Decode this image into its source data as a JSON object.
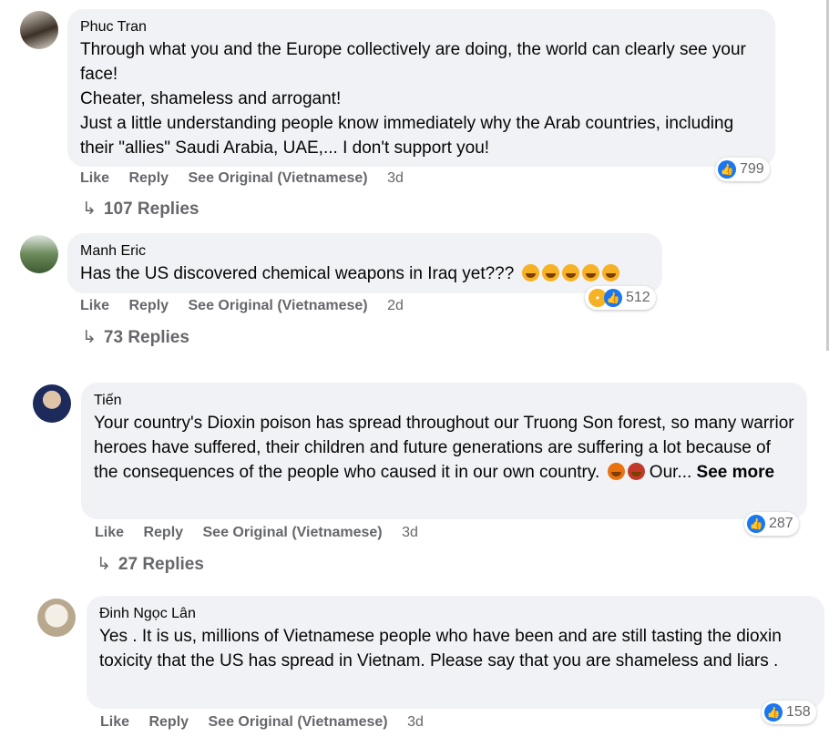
{
  "comments": [
    {
      "author": "Phuc Tran",
      "lines": [
        "Through what you and the Europe collectively are doing, the world can clearly see your face!",
        "Cheater, shameless and arrogant!",
        "Just a little understanding people know immediately why the Arab countries, including their \"allies\" Saudi Arabia, UAE,... I don't support you!"
      ],
      "actions": {
        "like": "Like",
        "reply": "Reply",
        "see_original": "See Original (Vietnamese)",
        "time": "3d"
      },
      "reaction_count": "799",
      "reaction_icons": [
        "like-icon"
      ],
      "replies": "107 Replies"
    },
    {
      "author": "Manh Eric",
      "lines": [
        "Has the US discovered chemical weapons in Iraq yet???"
      ],
      "emojis": [
        "laughing-emoji",
        "laughing-emoji",
        "laughing-emoji",
        "laughing-emoji",
        "laughing-emoji"
      ],
      "actions": {
        "like": "Like",
        "reply": "Reply",
        "see_original": "See Original (Vietnamese)",
        "time": "2d"
      },
      "reaction_count": "512",
      "reaction_icons": [
        "haha-icon",
        "like-icon"
      ],
      "replies": "73 Replies"
    },
    {
      "author": "Tiến",
      "lines": [
        "Your country's Dioxin poison has spread throughout our Truong Son forest, so many warrior heroes have suffered, their children and future generations are suffering a lot because of the consequences of the people who caused it in our own country."
      ],
      "emojis": [
        "angry-face-emoji",
        "cursing-face-emoji"
      ],
      "truncated_text": "Our...",
      "see_more": "See more",
      "actions": {
        "like": "Like",
        "reply": "Reply",
        "see_original": "See Original (Vietnamese)",
        "time": "3d"
      },
      "reaction_count": "287",
      "reaction_icons": [
        "like-icon"
      ],
      "replies": "27 Replies"
    },
    {
      "author": "Đinh Ngọc Lân",
      "lines": [
        "Yes . It is us, millions of Vietnamese people who have been and are still tasting the dioxin toxicity that the US has spread in Vietnam. Please say that you are shameless and liars ."
      ],
      "actions": {
        "like": "Like",
        "reply": "Reply",
        "see_original": "See Original (Vietnamese)",
        "time": "3d"
      },
      "reaction_count": "158",
      "reaction_icons": [
        "like-icon"
      ]
    }
  ],
  "colors": {
    "bubble": "#f0f2f5",
    "secondary_text": "#65676b",
    "like_blue": "#1877f2",
    "haha_yellow": "#f7b125"
  }
}
